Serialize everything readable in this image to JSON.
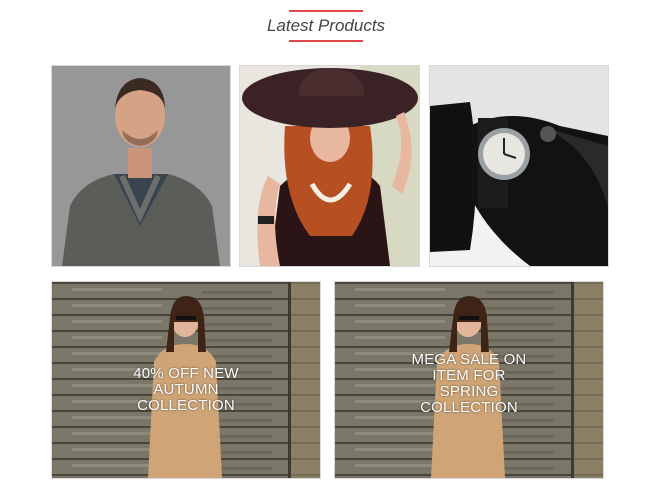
{
  "section": {
    "title": "Latest Products",
    "accent_color": "#e2494b"
  },
  "products": [
    {
      "name": "product-man-cardigan"
    },
    {
      "name": "product-woman-hat"
    },
    {
      "name": "product-watch"
    }
  ],
  "banners": [
    {
      "lines": [
        "40% OFF NEW",
        "AUTUMN",
        "COLLECTION"
      ]
    },
    {
      "lines": [
        "MEGA SALE ON",
        "ITEM FOR",
        "SPRING",
        "COLLECTION"
      ]
    }
  ]
}
